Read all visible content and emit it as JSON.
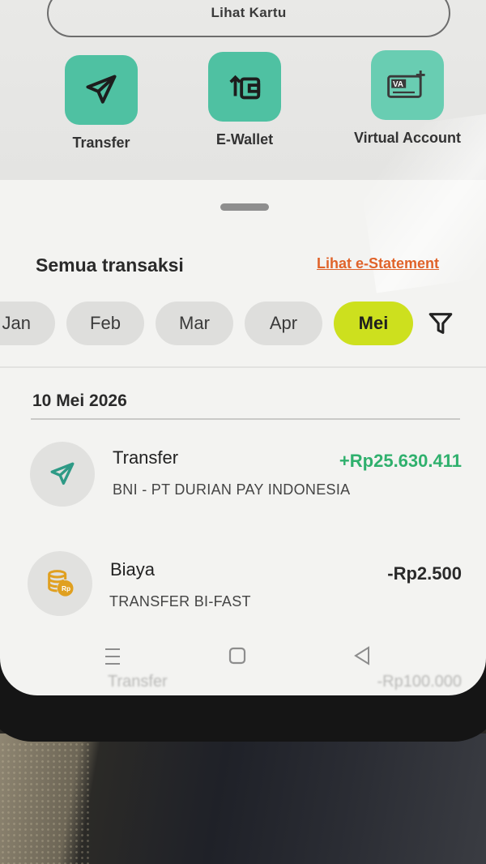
{
  "card": {
    "view_card_label": "Lihat Kartu"
  },
  "quick_actions": [
    {
      "label": "Transfer",
      "icon": "send-icon"
    },
    {
      "label": "E-Wallet",
      "icon": "wallet-transfer-icon"
    },
    {
      "label": "Virtual Account",
      "icon": "virtual-account-icon",
      "icon_text": "VA"
    }
  ],
  "transactions": {
    "title": "Semua transaksi",
    "estatement_link": "Lihat e-Statement",
    "months": [
      "Jan",
      "Feb",
      "Mar",
      "Apr",
      "Mei"
    ],
    "active_month": "Mei",
    "groups": [
      {
        "date": "10 Mei 2026",
        "items": [
          {
            "title": "Transfer",
            "subtitle": "BNI - PT DURIAN PAY INDONESIA",
            "amount": "+Rp25.630.411",
            "direction": "in",
            "icon": "send-icon"
          },
          {
            "title": "Biaya",
            "subtitle": "TRANSFER BI-FAST",
            "amount": "-Rp2.500",
            "direction": "out",
            "icon": "coin-stack-icon",
            "icon_text": "Rp"
          }
        ]
      }
    ],
    "partially_hidden_item": {
      "title": "Transfer",
      "amount": "-Rp100.000"
    }
  },
  "colors": {
    "accent_green": "#4fc1a2",
    "active_chip": "#cde01e",
    "link_orange": "#e0632a",
    "amount_positive": "#2fb06d",
    "fee_icon": "#e0a020"
  }
}
